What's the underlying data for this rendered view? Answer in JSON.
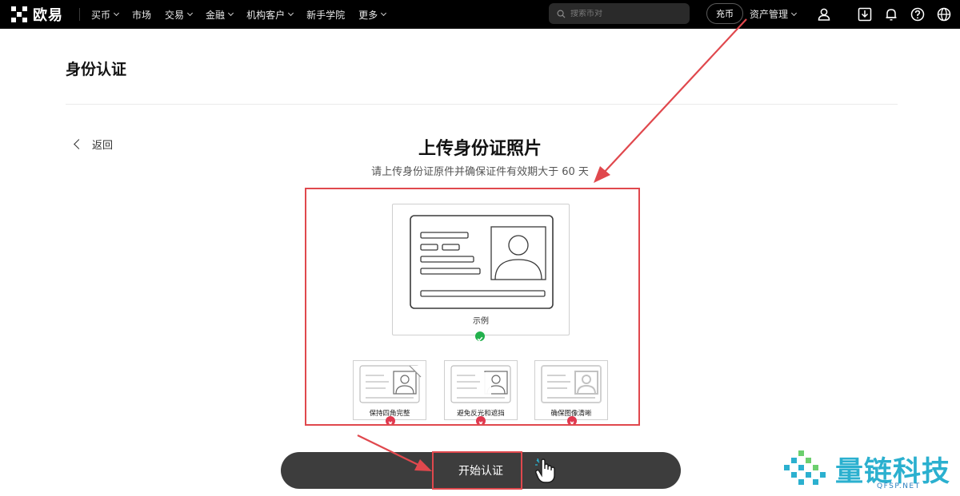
{
  "nav": {
    "brand": "欧易",
    "items": [
      {
        "label": "买币",
        "dropdown": true
      },
      {
        "label": "市场",
        "dropdown": false
      },
      {
        "label": "交易",
        "dropdown": true
      },
      {
        "label": "金融",
        "dropdown": true
      },
      {
        "label": "机构客户",
        "dropdown": true
      },
      {
        "label": "新手学院",
        "dropdown": false
      },
      {
        "label": "更多",
        "dropdown": true
      }
    ],
    "search_placeholder": "搜索币对",
    "deposit_label": "充币",
    "assets_label": "资产管理",
    "icons": [
      "user-icon",
      "download-icon",
      "bell-icon",
      "help-icon",
      "globe-icon"
    ]
  },
  "page": {
    "title": "身份认证",
    "back_label": "返回",
    "upload_title": "上传身份证照片",
    "upload_subtitle": "请上传身份证原件并确保证件有效期大于 60 天",
    "example_label": "示例",
    "tips": [
      {
        "label": "保持四角完整"
      },
      {
        "label": "避免反光和遮挡"
      },
      {
        "label": "确保图像清晰"
      }
    ],
    "start_button": "开始认证"
  },
  "colors": {
    "annotation_red": "#e0484d",
    "ok_green": "#22b14c",
    "bad_red": "#e0394f",
    "button_dark": "#3d3d3d"
  },
  "watermark": {
    "text": "量链科技",
    "url": "QFSP.NET"
  }
}
